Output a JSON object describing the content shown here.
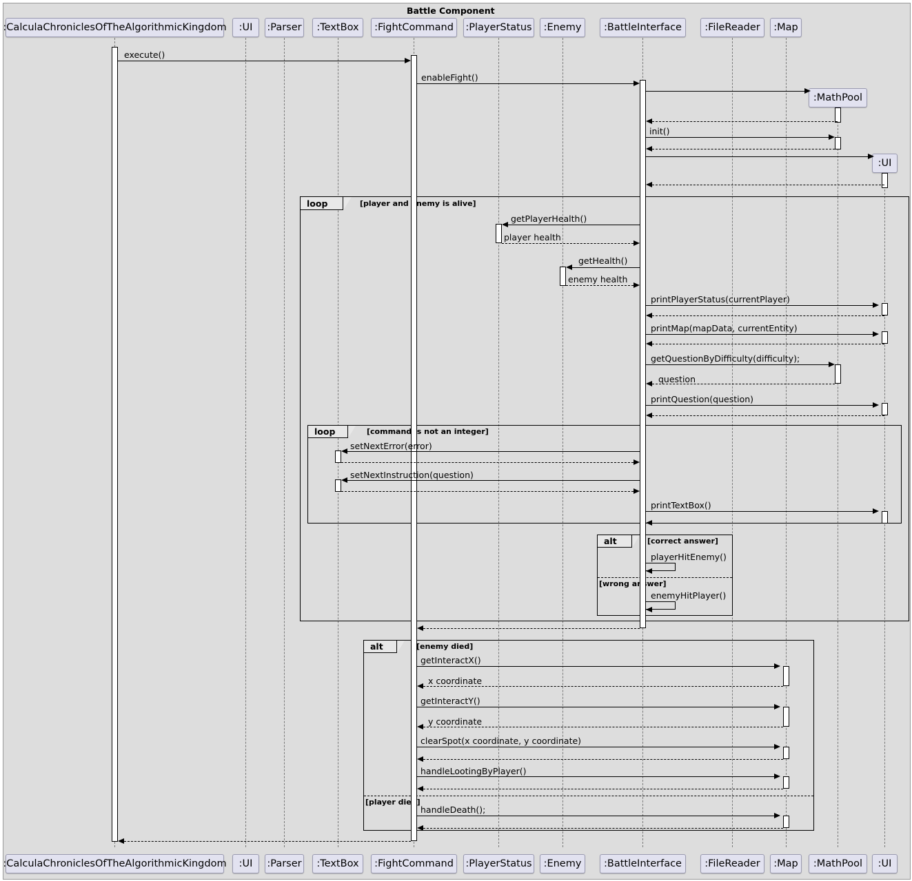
{
  "diagram": {
    "title": "Battle Component",
    "type": "uml-sequence-diagram"
  },
  "participants": [
    {
      "id": "game",
      "label": ":CalculaChroniclesOfTheAlgorithmicKingdom"
    },
    {
      "id": "ui",
      "label": ":UI"
    },
    {
      "id": "parser",
      "label": ":Parser"
    },
    {
      "id": "textbox",
      "label": ":TextBox"
    },
    {
      "id": "fight",
      "label": ":FightCommand"
    },
    {
      "id": "pstatus",
      "label": ":PlayerStatus"
    },
    {
      "id": "enemy",
      "label": ":Enemy"
    },
    {
      "id": "battle",
      "label": ":BattleInterface"
    },
    {
      "id": "filereader",
      "label": ":FileReader"
    },
    {
      "id": "map",
      "label": ":Map"
    },
    {
      "id": "mathpool",
      "label": ":MathPool"
    },
    {
      "id": "ui2",
      "label": ":UI"
    }
  ],
  "created_participants": [
    {
      "id": "mathpool",
      "label": ":MathPool"
    },
    {
      "id": "ui2",
      "label": ":UI"
    }
  ],
  "fragments": [
    {
      "id": "loop-alive",
      "kind": "loop",
      "guard": "[player and enemy is alive]"
    },
    {
      "id": "loop-integer",
      "kind": "loop",
      "guard": "[command is not an integer]"
    },
    {
      "id": "alt-answer",
      "kind": "alt",
      "guards": [
        "[correct answer]",
        "[wrong answer]"
      ]
    },
    {
      "id": "alt-death",
      "kind": "alt",
      "guards": [
        "[enemy died]",
        "[player died]"
      ]
    }
  ],
  "messages": [
    {
      "id": "m1",
      "label": "execute()",
      "kind": "call"
    },
    {
      "id": "m2",
      "label": "enableFight()",
      "kind": "call"
    },
    {
      "id": "m3",
      "label": "",
      "kind": "create"
    },
    {
      "id": "m4",
      "label": "",
      "kind": "return"
    },
    {
      "id": "m5",
      "label": "init()",
      "kind": "call"
    },
    {
      "id": "m6",
      "label": "",
      "kind": "return"
    },
    {
      "id": "m7",
      "label": "",
      "kind": "create"
    },
    {
      "id": "m8",
      "label": "",
      "kind": "return"
    },
    {
      "id": "m9",
      "label": "getPlayerHealth()",
      "kind": "call"
    },
    {
      "id": "m10",
      "label": "player health",
      "kind": "return"
    },
    {
      "id": "m11",
      "label": "getHealth()",
      "kind": "call"
    },
    {
      "id": "m12",
      "label": "enemy health",
      "kind": "return"
    },
    {
      "id": "m13",
      "label": "printPlayerStatus(currentPlayer)",
      "kind": "call"
    },
    {
      "id": "m14",
      "label": "",
      "kind": "return"
    },
    {
      "id": "m15",
      "label": "printMap(mapData, currentEntity)",
      "kind": "call"
    },
    {
      "id": "m16",
      "label": "",
      "kind": "return"
    },
    {
      "id": "m17",
      "label": "getQuestionByDifficulty(difficulty);",
      "kind": "call"
    },
    {
      "id": "m18",
      "label": "question",
      "kind": "return"
    },
    {
      "id": "m19",
      "label": "printQuestion(question)",
      "kind": "call"
    },
    {
      "id": "m20",
      "label": "",
      "kind": "return"
    },
    {
      "id": "m21",
      "label": "setNextError(error)",
      "kind": "call"
    },
    {
      "id": "m22",
      "label": "",
      "kind": "return"
    },
    {
      "id": "m23",
      "label": "setNextInstruction(question)",
      "kind": "call"
    },
    {
      "id": "m24",
      "label": "",
      "kind": "return"
    },
    {
      "id": "m25",
      "label": "printTextBox()",
      "kind": "call"
    },
    {
      "id": "m26",
      "label": "",
      "kind": "return"
    },
    {
      "id": "m27",
      "label": "playerHitEnemy()",
      "kind": "self"
    },
    {
      "id": "m28",
      "label": "enemyHitPlayer()",
      "kind": "self"
    },
    {
      "id": "m29",
      "label": "",
      "kind": "return"
    },
    {
      "id": "m30",
      "label": "getInteractX()",
      "kind": "call"
    },
    {
      "id": "m31",
      "label": "x coordinate",
      "kind": "return"
    },
    {
      "id": "m32",
      "label": "getInteractY()",
      "kind": "call"
    },
    {
      "id": "m33",
      "label": "y coordinate",
      "kind": "return"
    },
    {
      "id": "m34",
      "label": "clearSpot(x coordinate, y coordinate)",
      "kind": "call"
    },
    {
      "id": "m35",
      "label": "",
      "kind": "return"
    },
    {
      "id": "m36",
      "label": "handleLootingByPlayer()",
      "kind": "call"
    },
    {
      "id": "m37",
      "label": "",
      "kind": "return"
    },
    {
      "id": "m38",
      "label": "handleDeath();",
      "kind": "call"
    },
    {
      "id": "m39",
      "label": "",
      "kind": "return"
    },
    {
      "id": "m40",
      "label": "",
      "kind": "return"
    }
  ],
  "colors": {
    "participant_fill": "#e2e2f0",
    "participant_border": "#9a9ab0",
    "frame_fill": "#dddddd",
    "frame_border": "#999999",
    "activation_fill": "#ffffff",
    "line": "#000000"
  }
}
